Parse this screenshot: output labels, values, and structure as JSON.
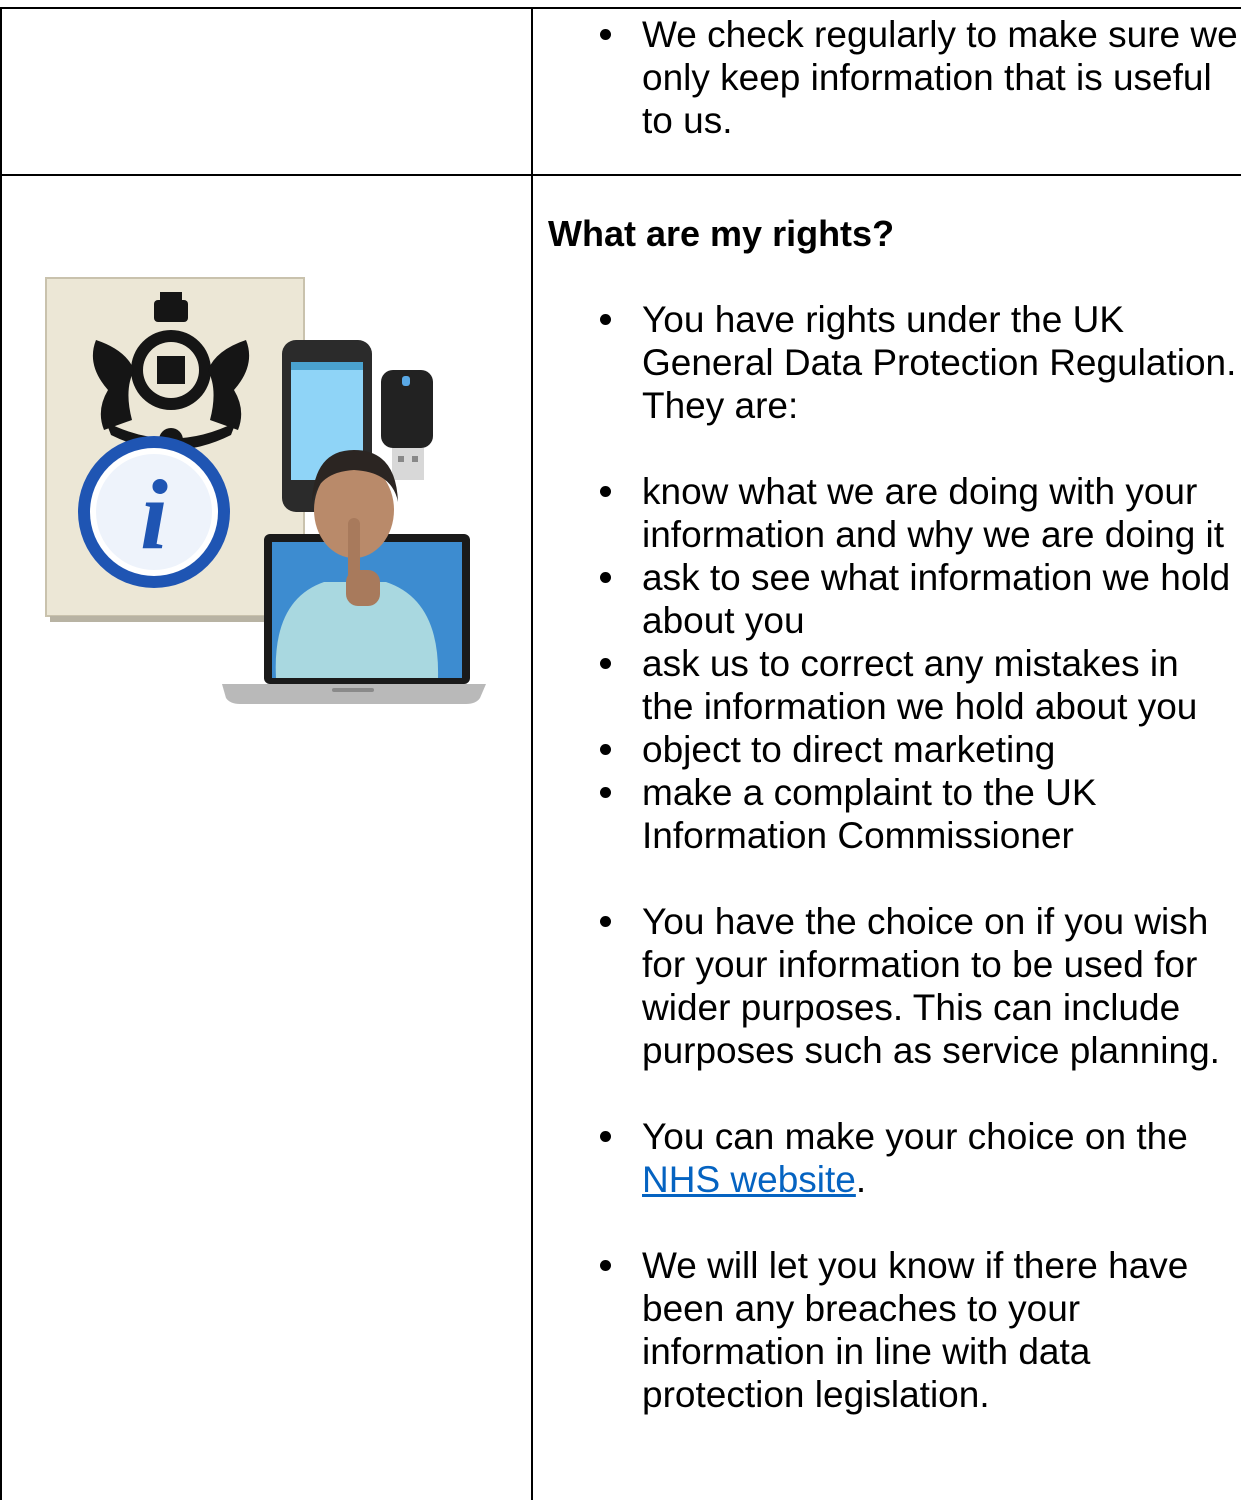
{
  "top_cell": {
    "bullets": [
      "We check regularly to make sure we only keep information that is useful to us."
    ]
  },
  "rights_section": {
    "heading": "What are my rights?",
    "intro": "You have rights under the UK General Data Protection Regulation. They are:",
    "rights": [
      "know what we are doing with your information and why we are doing it",
      "ask to see what information we hold about you",
      "ask us to correct any mistakes in the information we hold about you",
      "object to direct marketing",
      "make a complaint to the UK Information Commissioner"
    ],
    "choice": "You have the choice on if you wish for your information to be used for wider purposes. This can include purposes such as service planning.",
    "nhs_prefix": "You can make your choice on the ",
    "nhs_link": "NHS website",
    "nhs_suffix": ".",
    "breaches": "We will let you know if there have been any breaches to your information in line with data protection legislation."
  },
  "illustration": {
    "icon_letter": "i",
    "colors": {
      "paper": "#ece7d6",
      "info_blue": "#1f55b3",
      "screen": "#3d8cd0",
      "sweater": "#a9d8e0"
    }
  }
}
